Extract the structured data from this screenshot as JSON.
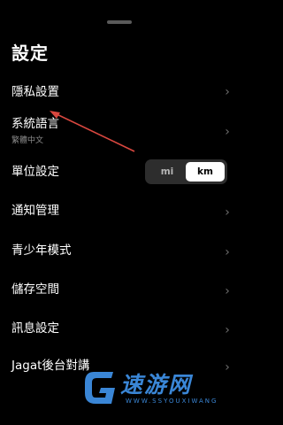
{
  "header": {
    "title": "設定"
  },
  "rows": [
    {
      "label": "隱私設置"
    },
    {
      "label": "系統語言",
      "sub": "繁體中文"
    },
    {
      "label": "單位設定"
    },
    {
      "label": "通知管理"
    },
    {
      "label": "青少年模式"
    },
    {
      "label": "儲存空間"
    },
    {
      "label": "訊息設定"
    },
    {
      "label": "Jagat後台對講"
    }
  ],
  "unit_toggle": {
    "options": [
      "mi",
      "km"
    ],
    "selected": "km"
  },
  "colors": {
    "background": "#000000",
    "arrow": "#d9473f",
    "watermark": "#3a86d6"
  },
  "watermark": {
    "brand": "速游网",
    "sub": "WWW.SSYOUXIWANG"
  }
}
